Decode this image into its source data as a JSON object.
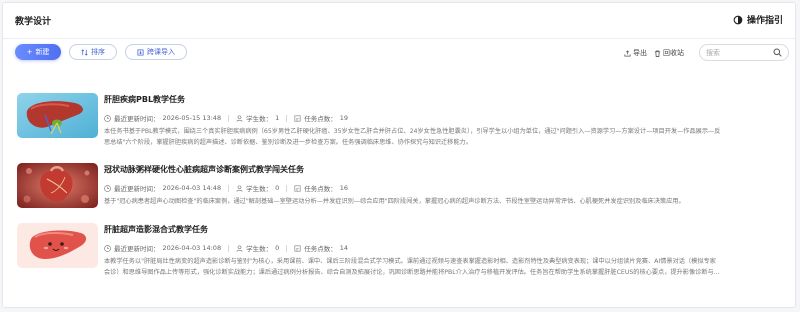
{
  "header": {
    "title": "教学设计",
    "guide_label": "操作指引"
  },
  "toolbar": {
    "new_label": "新建",
    "sort_label": "排序",
    "import_label": "跨课导入",
    "export_label": "导出",
    "recycle_label": "回收站",
    "search_placeholder": "搜索"
  },
  "items": [
    {
      "title": "肝胆疾病PBL教学任务",
      "last_update_label": "最近更新时间：",
      "last_update": "2026-05-15 13:48",
      "students_label": "学生数：",
      "students": "1",
      "tasks_label": "任务点数：",
      "tasks": "19",
      "desc_line1": "本任务书基于PBL教学模式，围绕三个真实肝胆疾病病例（65岁男性乙肝硬化肝癌、35岁女性乙肝合并肝占位、24岁女性急性胆囊炎），引导学生以小组为单位，通过\"问题引入—资源学习—方案设计—项目开发—作品展示—反",
      "desc_line2": "思总结\"六个阶段，掌握肝胆疾病的超声描述、诊断依据、鉴别诊断及进一步检查方案。任务强调临床思维、协作探究与知识迁移能力。",
      "thumb": "liver-thumbnail"
    },
    {
      "title": "冠状动脉粥样硬化性心脏病超声诊断案例式教学闯关任务",
      "last_update_label": "最近更新时间：",
      "last_update": "2026-04-03 14:48",
      "students_label": "学生数：",
      "students": "0",
      "tasks_label": "任务点数：",
      "tasks": "16",
      "desc_line1": "基于\"冠心病患者超声心动图检查\"的临床案例，通过\"解剖基础—室壁运动分析—并发症识别—综合应用\"四阶段闯关，掌握冠心病的超声诊断方法、节段性室壁运动异常评估、心肌梗死并发症识别及临床决策应用。",
      "desc_line2": "",
      "thumb": "heart-thumbnail"
    },
    {
      "title": "肝脏超声造影混合式教学任务",
      "last_update_label": "最近更新时间：",
      "last_update": "2026-04-03 14:08",
      "students_label": "学生数：",
      "students": "0",
      "tasks_label": "任务点数：",
      "tasks": "14",
      "desc_line1": "本教学任务以\"肝脏局灶性病变的超声造影诊断与鉴别\"为核心，采用课前、课中、课后三阶段混合式学习模式。课前通过视频与速查表掌握造影时相、造影剂特性及典型病变表现；课中以分组读片竞赛、AI情景对话（模拟专家",
      "desc_line2": "会诊）和思维导图作品上传等形式，强化诊断实战能力；课后通过病例分析报告、综合自测及拓展讨论，巩固诊断思路并能将PBL介入治疗与移植开发评估。任务旨在帮助学生系统掌握肝脏CEUS的核心要点，提升影像诊断与...",
      "thumb": "liver-cartoon-thumbnail"
    }
  ]
}
